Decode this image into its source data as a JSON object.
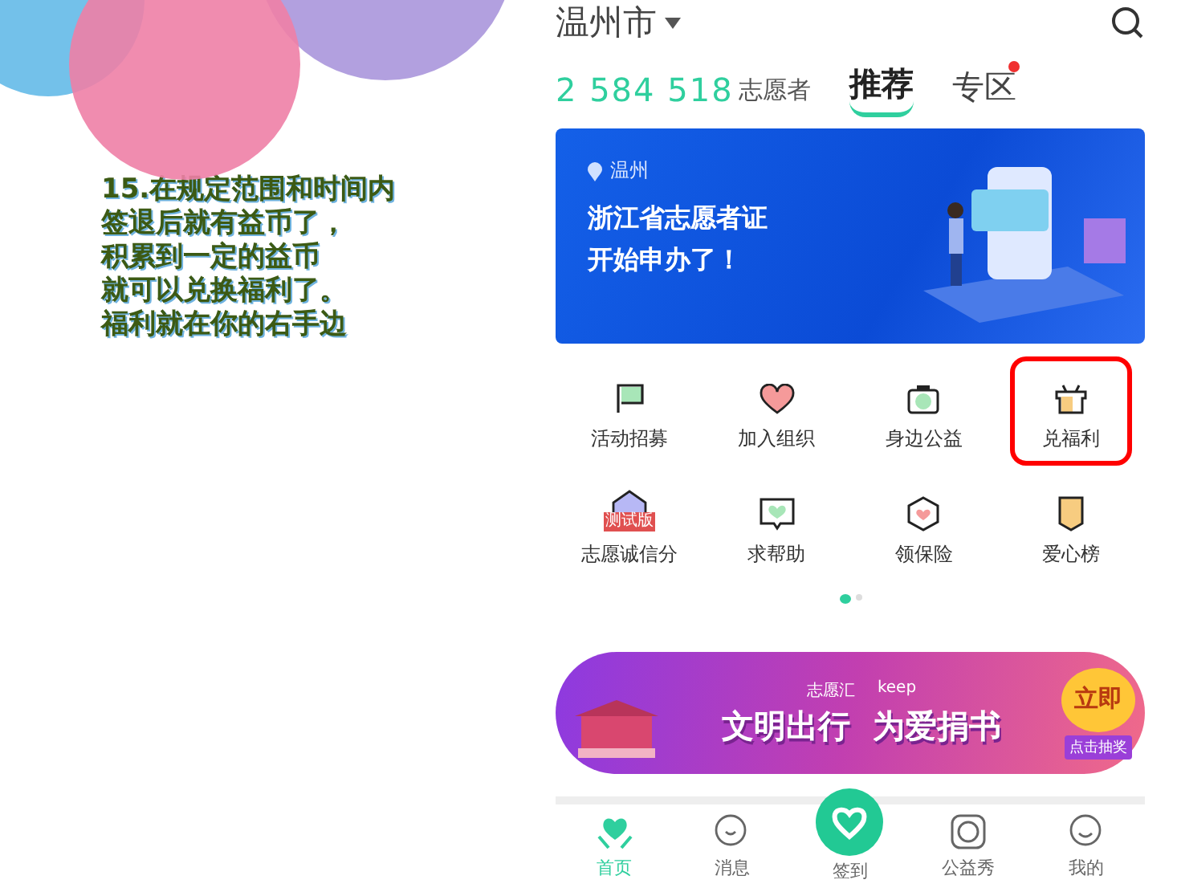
{
  "caption": {
    "lines": [
      "15.在规定范围和时间内",
      "签退后就有益币了，",
      "积累到一定的益币",
      "就可以兑换福利了。",
      "福利就在你的右手边"
    ]
  },
  "header": {
    "city": "温州市",
    "counter": "2 584 518",
    "counter_unit": "志愿者",
    "tabs": [
      {
        "label": "推荐",
        "selected": true,
        "dot": false
      },
      {
        "label": "专区",
        "selected": false,
        "dot": true
      }
    ]
  },
  "banner": {
    "location": "温州",
    "title_lines": [
      "浙江省志愿者证",
      "开始申办了！"
    ]
  },
  "grid": [
    {
      "label": "活动招募",
      "kind": "flag",
      "highlighted": false
    },
    {
      "label": "加入组织",
      "kind": "heart",
      "highlighted": false
    },
    {
      "label": "身边公益",
      "kind": "camera",
      "highlighted": false
    },
    {
      "label": "兑福利",
      "kind": "gift",
      "highlighted": true
    },
    {
      "label": "志愿诚信分",
      "kind": "house",
      "badge": "测试版",
      "highlighted": false
    },
    {
      "label": "求帮助",
      "kind": "chat",
      "highlighted": false
    },
    {
      "label": "领保险",
      "kind": "shield",
      "highlighted": false
    },
    {
      "label": "爱心榜",
      "kind": "ribbon",
      "highlighted": false
    }
  ],
  "promo": {
    "brands": [
      "志愿汇",
      "keep"
    ],
    "title": "文明出行  为爱捐书",
    "button": "立即",
    "sticker": "点击抽奖"
  },
  "nav": [
    {
      "label": "首页",
      "kind": "home",
      "selected": true
    },
    {
      "label": "消息",
      "kind": "message",
      "selected": false
    },
    {
      "label": "签到",
      "kind": "checkin",
      "selected": false
    },
    {
      "label": "公益秀",
      "kind": "camera",
      "selected": false
    },
    {
      "label": "我的",
      "kind": "face",
      "selected": false
    }
  ]
}
